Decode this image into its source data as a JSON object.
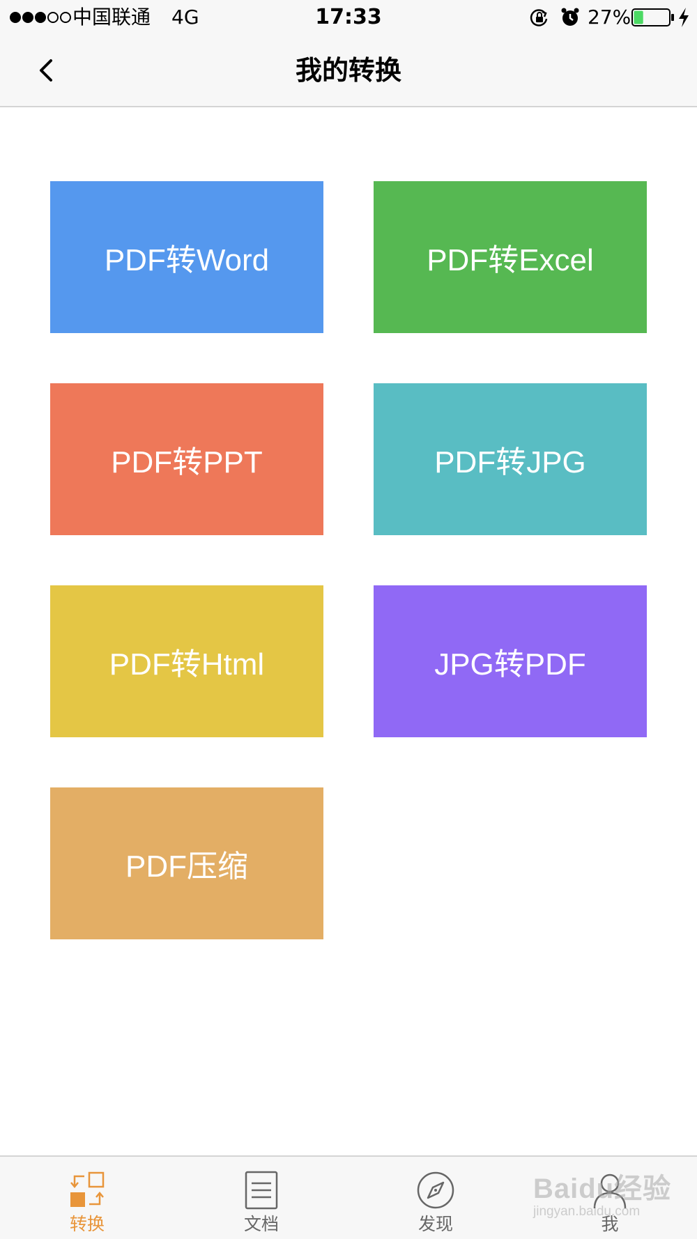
{
  "status_bar": {
    "signal_dots": [
      "full",
      "full",
      "full",
      "empty",
      "empty"
    ],
    "carrier": "中国联通",
    "network": "4G",
    "time": "17:33",
    "battery_percent": "27%",
    "battery_level": 0.27,
    "battery_color": "#4cd964"
  },
  "nav_bar": {
    "back_icon": "chevron-left-icon",
    "title": "我的转换"
  },
  "tiles": [
    {
      "label": "PDF转Word",
      "color": "#5598ee"
    },
    {
      "label": "PDF转Excel",
      "color": "#56b852"
    },
    {
      "label": "PDF转PPT",
      "color": "#ee7859"
    },
    {
      "label": "PDF转JPG",
      "color": "#59bdc3"
    },
    {
      "label": "PDF转Html",
      "color": "#e4c645"
    },
    {
      "label": "JPG转PDF",
      "color": "#9069f5"
    },
    {
      "label": "PDF压缩",
      "color": "#e3ae65"
    }
  ],
  "tab_bar": {
    "active_color": "#e8953a",
    "inactive_color": "#666666",
    "tabs": [
      {
        "label": "转换",
        "icon": "convert-icon",
        "active": true
      },
      {
        "label": "文档",
        "icon": "document-icon",
        "active": false
      },
      {
        "label": "发现",
        "icon": "compass-icon",
        "active": false
      },
      {
        "label": "我",
        "icon": "profile-icon",
        "active": false
      }
    ]
  },
  "watermark": {
    "logo": "Baidu经验",
    "url": "jingyan.baidu.com"
  }
}
